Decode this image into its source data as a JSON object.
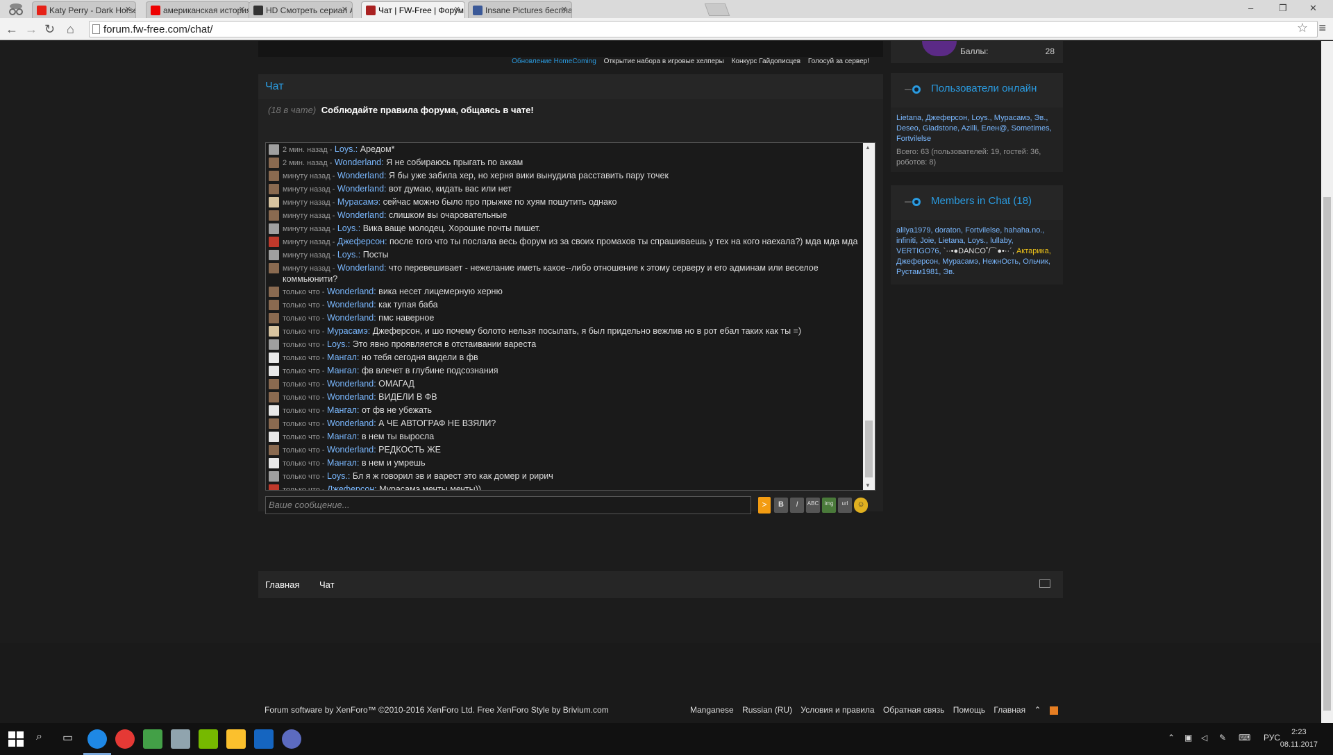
{
  "browser": {
    "tabs": [
      {
        "label": "Katy Perry - Dark Horse (C",
        "color": "#e62117"
      },
      {
        "label": "американская история у",
        "color": "#e00"
      },
      {
        "label": "HD Смотреть сериал Амери",
        "color": "#333"
      },
      {
        "label": "Чат | FW-Free | Форум",
        "color": "#aa2222"
      },
      {
        "label": "Insane Pictures бесплатн",
        "color": "#3b5998"
      }
    ],
    "active_tab": 3,
    "url": "forum.fw-free.com/chat/",
    "window_controls": [
      "–",
      "❐",
      "✕"
    ]
  },
  "notices": [
    "Обновление HomeComing",
    "Открытие набора в игровые хелперы",
    "Конкурс Гайдописцев",
    "Голосуй за сервер!"
  ],
  "profile": {
    "score_label": "Баллы:",
    "score_value": "28"
  },
  "chat": {
    "title": "Чат",
    "in_chat": "(18 в чате)",
    "rules": "Соблюдайте правила форума, общаясь в чате!",
    "input_placeholder": "Ваше сообщение...",
    "send_label": ">",
    "format_buttons": [
      "B",
      "I",
      "ABC",
      "img",
      "url",
      "☺"
    ],
    "messages": [
      {
        "time": "2 мин. назад -",
        "user": "Loys.:",
        "text": "Аредом*",
        "avatar": "#a0a0a0"
      },
      {
        "time": "2 мин. назад -",
        "user": "Wonderland:",
        "text": "Я не собираюсь прыгать по аккам",
        "avatar": "#8a6a50"
      },
      {
        "time": "минуту назад -",
        "user": "Wonderland:",
        "text": "Я бы уже забила хер, но херня вики вынудила расставить пару точек",
        "avatar": "#8a6a50"
      },
      {
        "time": "минуту назад -",
        "user": "Wonderland:",
        "text": "вот думаю, кидать вас или нет",
        "avatar": "#8a6a50"
      },
      {
        "time": "минуту назад -",
        "user": "Мурасамэ:",
        "text": "сейчас можно было про прыжке по хуям пошутить однако",
        "avatar": "#d8c4a0"
      },
      {
        "time": "минуту назад -",
        "user": "Wonderland:",
        "text": "слишком вы очаровательные",
        "avatar": "#8a6a50"
      },
      {
        "time": "минуту назад -",
        "user": "Loys.:",
        "text": "Вика ваще молодец. Хорошие почты пишет.",
        "avatar": "#a0a0a0"
      },
      {
        "time": "минуту назад -",
        "user": "Джеферсон:",
        "text": "после того что ты послала весь форум из за своих промахов ты спрашиваешь у тех на кого наехала?) мда мда мда",
        "avatar": "#c0392b"
      },
      {
        "time": "минуту назад -",
        "user": "Loys.:",
        "text": "Посты",
        "avatar": "#a0a0a0"
      },
      {
        "time": "минуту назад -",
        "user": "Wonderland:",
        "text": "что перевешивает - нежелание иметь какое--либо отношение к этому серверу и его админам или веселое коммьюнити?",
        "avatar": "#8a6a50"
      },
      {
        "time": "только что -",
        "user": "Wonderland:",
        "text": "вика несет лицемерную херню",
        "avatar": "#8a6a50"
      },
      {
        "time": "только что -",
        "user": "Wonderland:",
        "text": "как тупая баба",
        "avatar": "#8a6a50"
      },
      {
        "time": "только что -",
        "user": "Wonderland:",
        "text": "пмс наверное",
        "avatar": "#8a6a50"
      },
      {
        "time": "только что -",
        "user": "Мурасамэ:",
        "text": "Джеферсон, и шо почему болото нельзя посылать, я был придельно вежлив но в рот ебал таких как ты =)",
        "avatar": "#d8c4a0"
      },
      {
        "time": "только что -",
        "user": "Loys.:",
        "text": "Это явно проявляется в отстаивании вареста",
        "avatar": "#a0a0a0"
      },
      {
        "time": "только что -",
        "user": "Мангал:",
        "text": "но тебя сегодня видели в фв",
        "avatar": "#e8e8e8"
      },
      {
        "time": "только что -",
        "user": "Мангал:",
        "text": "фв влечет в глубине подсознания",
        "avatar": "#e8e8e8"
      },
      {
        "time": "только что -",
        "user": "Wonderland:",
        "text": "ОМАГАД",
        "avatar": "#8a6a50"
      },
      {
        "time": "только что -",
        "user": "Wonderland:",
        "text": "ВИДЕЛИ В ФВ",
        "avatar": "#8a6a50"
      },
      {
        "time": "только что -",
        "user": "Мангал:",
        "text": "от фв не убежать",
        "avatar": "#e8e8e8"
      },
      {
        "time": "только что -",
        "user": "Wonderland:",
        "text": "А ЧЕ АВТОГРАФ НЕ ВЗЯЛИ?",
        "avatar": "#8a6a50"
      },
      {
        "time": "только что -",
        "user": "Мангал:",
        "text": "в нем ты выросла",
        "avatar": "#e8e8e8"
      },
      {
        "time": "только что -",
        "user": "Wonderland:",
        "text": "РЕДКОСТЬ ЖЕ",
        "avatar": "#8a6a50"
      },
      {
        "time": "только что -",
        "user": "Мангал:",
        "text": "в нем и умрешь",
        "avatar": "#e8e8e8"
      },
      {
        "time": "только что -",
        "user": "Loys.:",
        "text": "Бл я ж говорил эв и варест это как домер и ририч",
        "avatar": "#a0a0a0"
      },
      {
        "time": "только что -",
        "user": "Джеферсон:",
        "text": "Мурасамэ мечты мечты))",
        "avatar": "#c0392b"
      }
    ]
  },
  "online_users": {
    "title": "Пользователи онлайн",
    "users": [
      "Lietana,",
      "Джеферсон,",
      "Loys.,",
      "Мурасамэ,",
      "Эв.,",
      "Deseo,",
      "Gladstone,",
      "Azilli,",
      "Елен@,",
      "Sometimes,",
      "Fortvilelse"
    ],
    "total": "Всего: 63 (пользователей: 19, гостей: 36, роботов: 8)"
  },
  "chat_members": {
    "title": "Members in Chat (18)",
    "users": [
      {
        "name": "alilya1979,",
        "style": ""
      },
      {
        "name": "doraton,",
        "style": ""
      },
      {
        "name": "Fortvilelse,",
        "style": ""
      },
      {
        "name": "hahaha.no.,",
        "style": ""
      },
      {
        "name": "infiniti,",
        "style": ""
      },
      {
        "name": "Joie,",
        "style": ""
      },
      {
        "name": "Lietana,",
        "style": ""
      },
      {
        "name": "Loys.,",
        "style": ""
      },
      {
        "name": "lullaby,",
        "style": ""
      },
      {
        "name": "VERTIGO76,",
        "style": ""
      },
      {
        "name": "`··•●DANCO˚/¯`●•··´,",
        "style": "white"
      },
      {
        "name": "Актарика,",
        "style": "gold"
      },
      {
        "name": "Джеферсон,",
        "style": ""
      },
      {
        "name": "Мурасамэ,",
        "style": ""
      },
      {
        "name": "НежнОсть,",
        "style": ""
      },
      {
        "name": "Ольчик,",
        "style": ""
      },
      {
        "name": "Рустам1981,",
        "style": ""
      },
      {
        "name": "Эв.",
        "style": ""
      }
    ]
  },
  "footer_nav": {
    "home": "Главная",
    "chat": "Чат"
  },
  "footer": {
    "copyright": "Forum software by XenForo™ ©2010-2016 XenForo Ltd. Free XenForo Style by Brivium.com",
    "links": [
      "Manganese",
      "Russian (RU)",
      "Условия и правила",
      "Обратная связь",
      "Помощь",
      "Главная"
    ]
  },
  "taskbar": {
    "icons": [
      "windows-start-icon",
      "search-icon",
      "task-view-icon",
      "chrome-icon",
      "yandex-icon",
      "apps-icon",
      "network-icon",
      "nvidia-icon",
      "folder-icon",
      "word-icon",
      "game-icon"
    ],
    "lang": "РУС",
    "time": "2:23",
    "date": "08.11.2017"
  }
}
